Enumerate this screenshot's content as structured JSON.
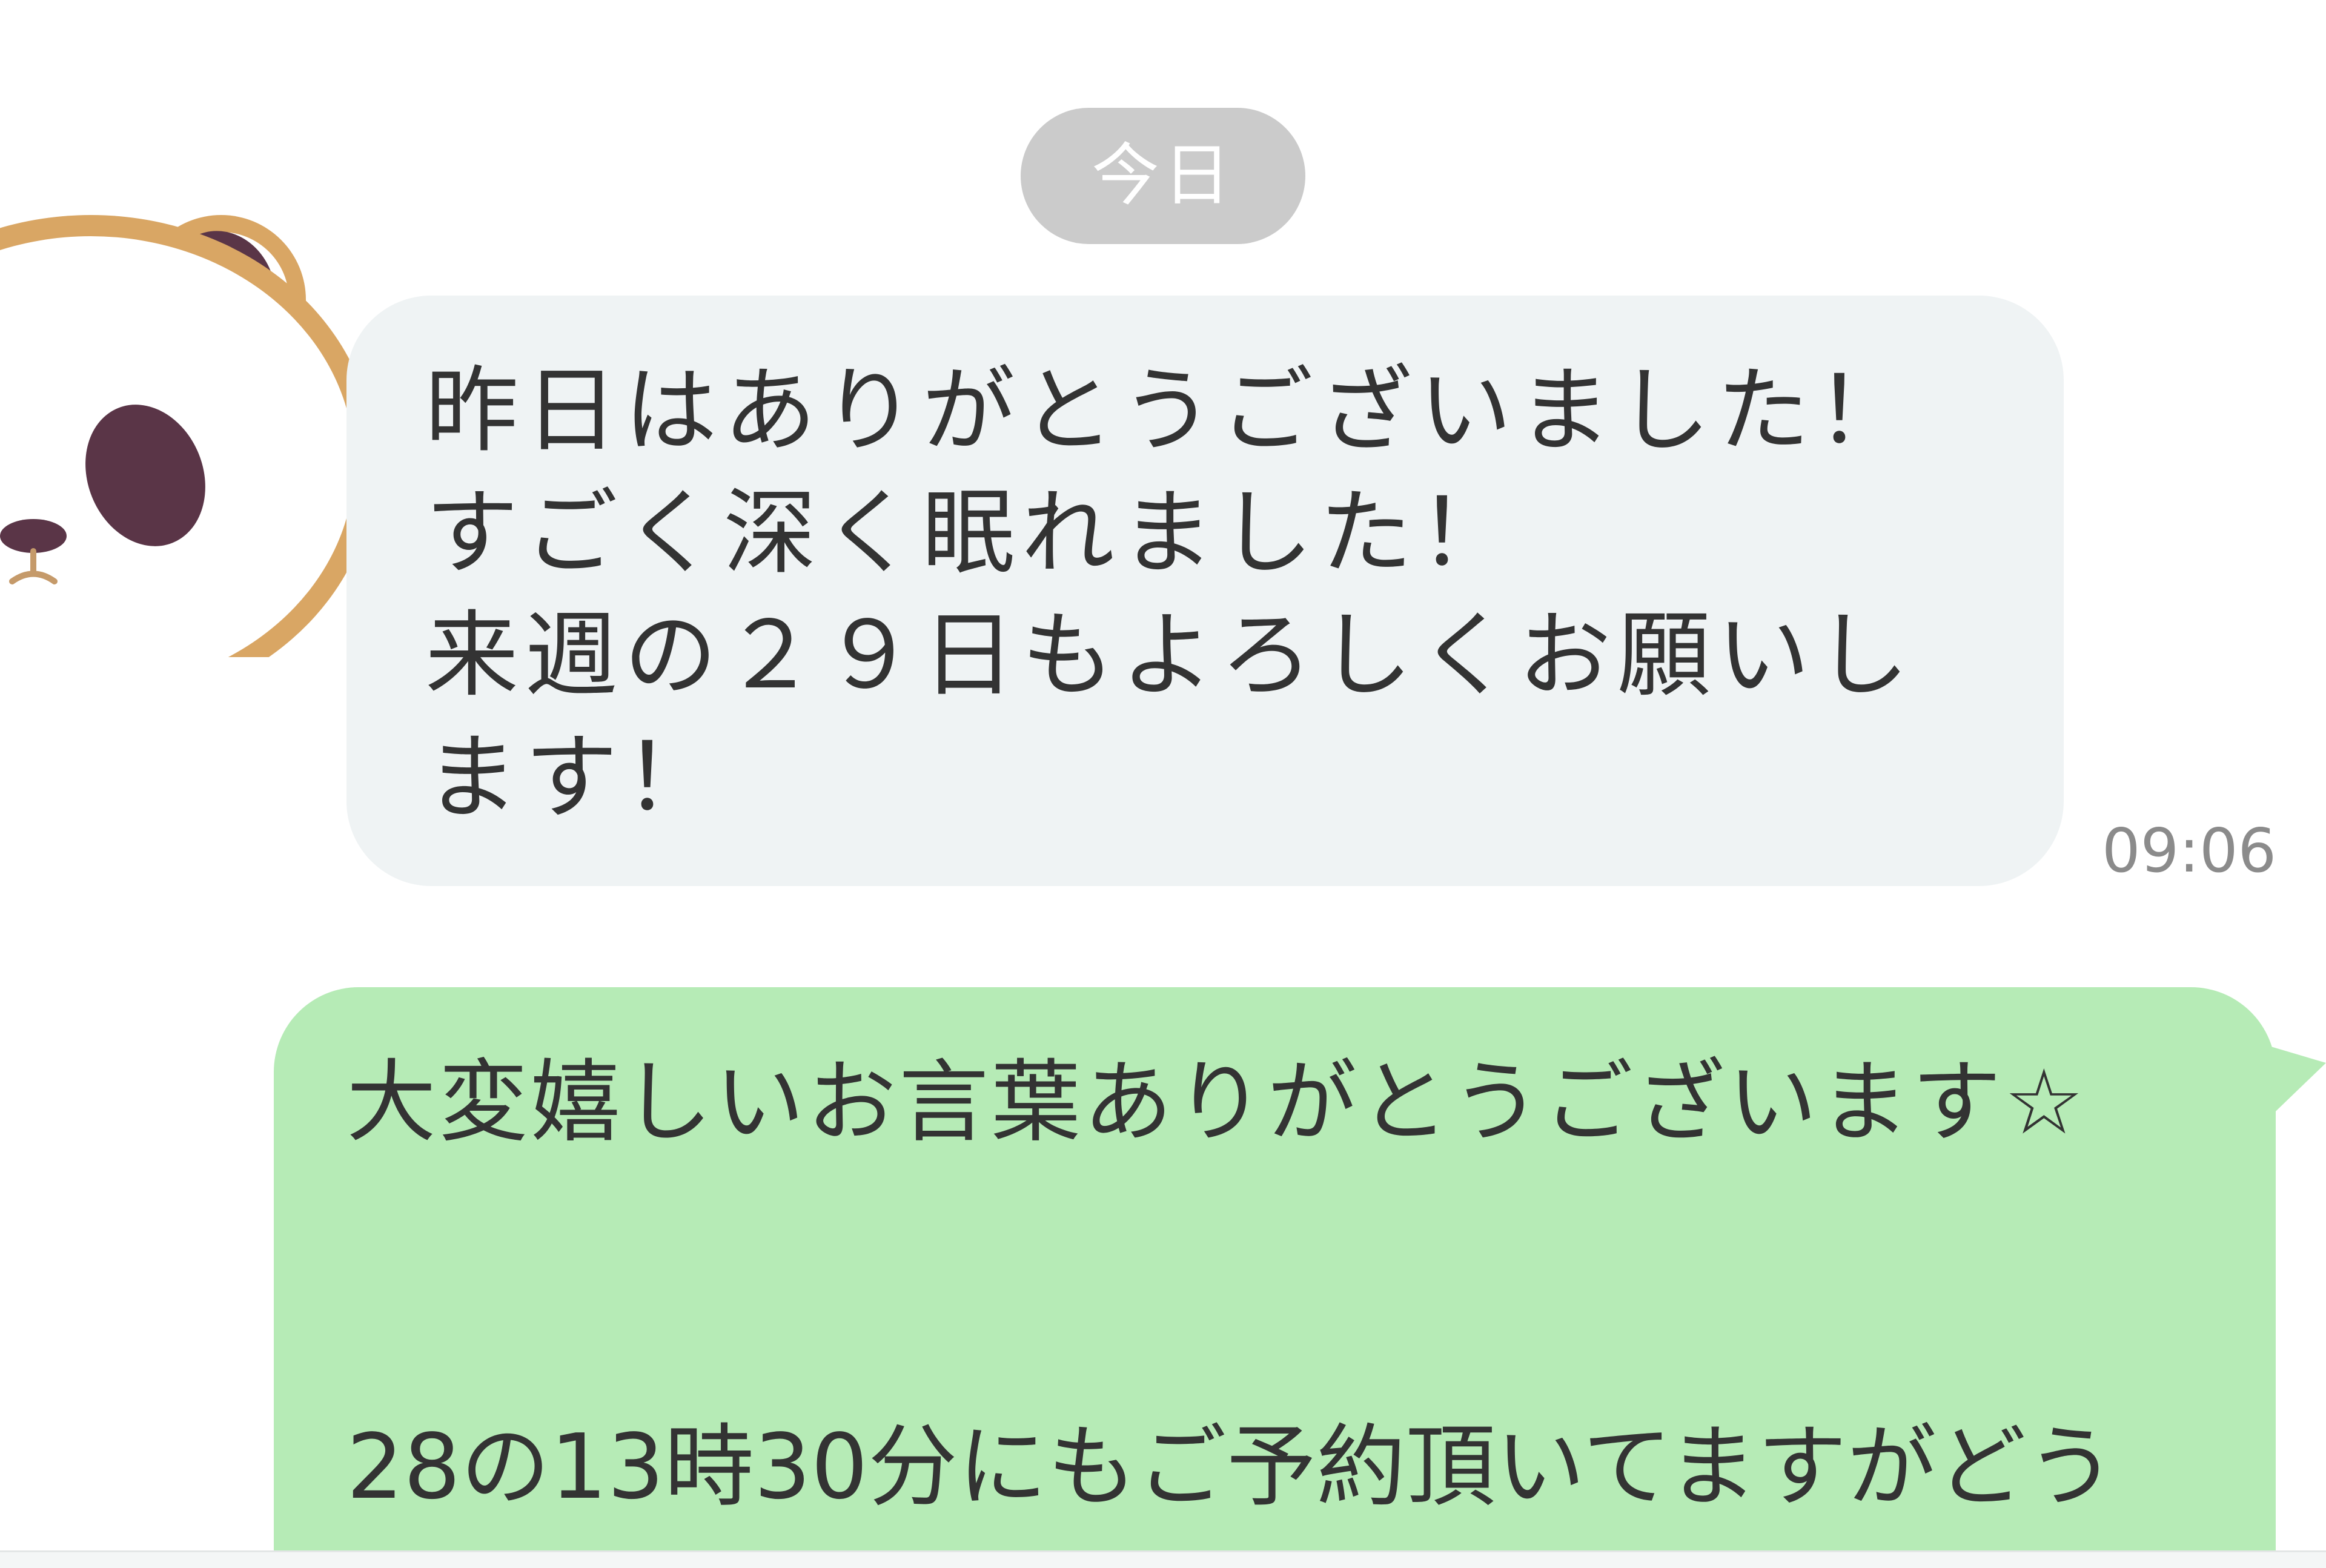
{
  "chat": {
    "date_divider": "今日",
    "incoming": {
      "avatar": "panda-face-icon",
      "text": "昨日はありがとうございました！すごく深く眠れました！\n来週の２９日もよろしくお願いします！",
      "lines": [
        "昨日はありがとうございました！す",
        "ごく深く眠れました！",
        "来週の２９日もよろしくお願いしま",
        "す！"
      ],
      "time": "09:06"
    },
    "outgoing": {
      "line1": "大変嬉しいお言葉ありがとうございます☆",
      "line2": "28の13時30分にもご予約頂いてますがどう"
    }
  },
  "colors": {
    "incoming_bubble": "#eff3f4",
    "outgoing_bubble": "#b6ebb6",
    "date_pill": "#cbcbcb",
    "text": "#333333",
    "timestamp": "#8b8b8b",
    "avatar_border": "#d9a664",
    "avatar_patch": "#5a3547"
  }
}
